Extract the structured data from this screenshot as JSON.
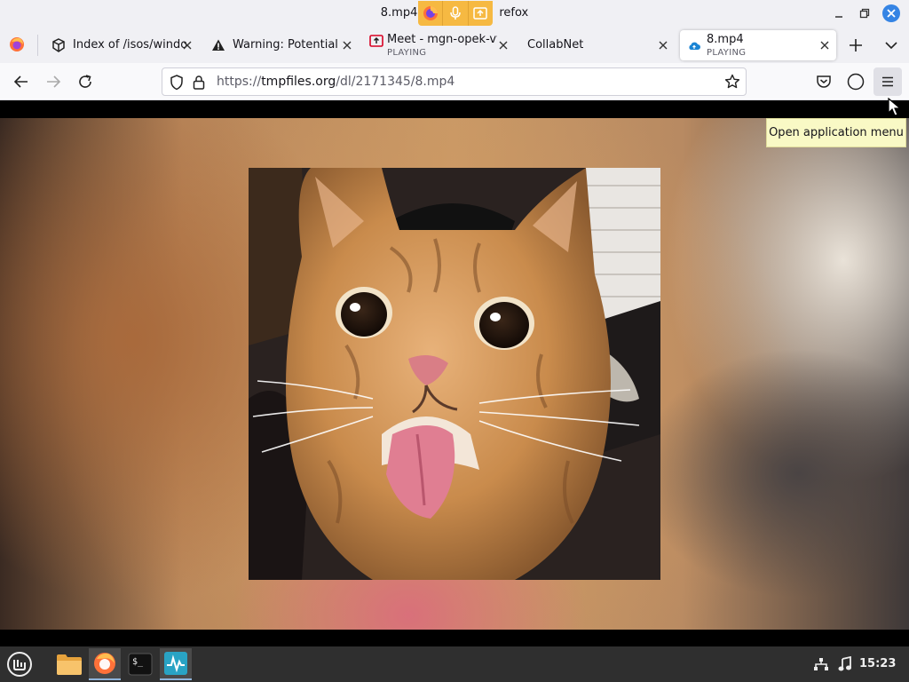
{
  "window": {
    "title_left": "8.mp4",
    "title_right": "refox"
  },
  "tabs": [
    {
      "title": "Index of /isos/windo",
      "icon": "package-icon",
      "subtitle": ""
    },
    {
      "title": "Warning: Potential S",
      "icon": "warning-icon",
      "subtitle": ""
    },
    {
      "title": "Meet - mgn-opek-vt",
      "icon": "screen-share-icon",
      "subtitle": "PLAYING"
    },
    {
      "title": "CollabNet",
      "icon": "",
      "subtitle": ""
    },
    {
      "title": "8.mp4",
      "icon": "cloud-upload-icon",
      "subtitle": "PLAYING",
      "selected": true
    }
  ],
  "navbar": {
    "url_prefix": "https://",
    "url_host": "tmpfiles.org",
    "url_path": "/dl/2171345/8.mp4"
  },
  "tooltip": {
    "text": "Open application menu"
  },
  "taskbar": {
    "clock": "15:23",
    "apps": [
      "menu-icon",
      "files-icon",
      "firefox-icon",
      "terminal-icon",
      "system-monitor-icon"
    ]
  },
  "colors": {
    "accent": "#3584e4",
    "sharing_indicator": "#f6b942"
  }
}
